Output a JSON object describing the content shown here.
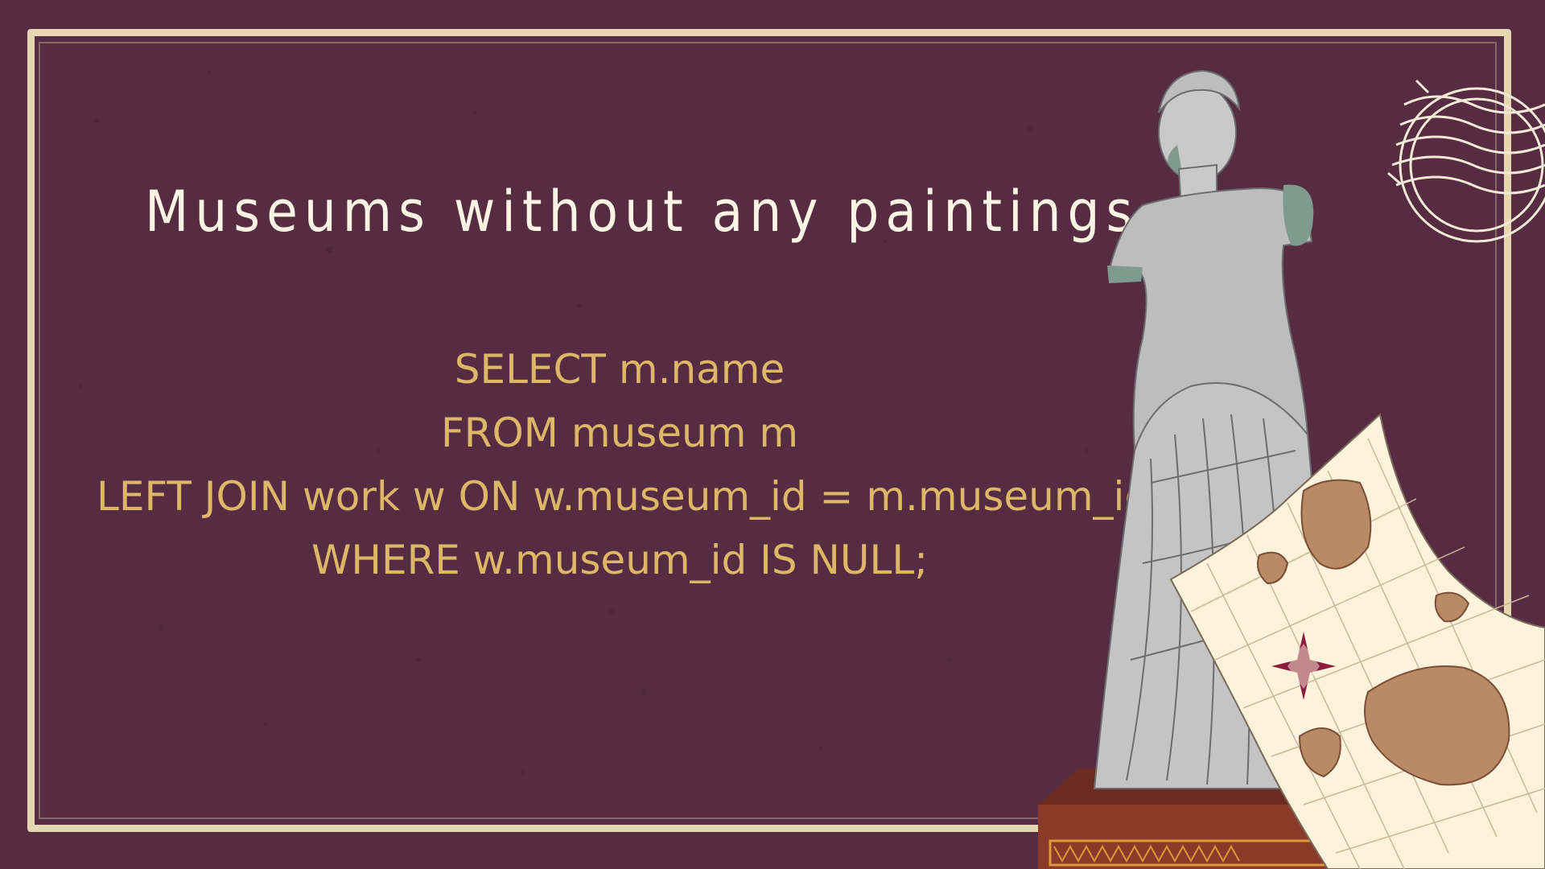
{
  "slide": {
    "title": "Museums without any paintings",
    "code_lines": [
      "SELECT m.name",
      "FROM museum m",
      "LEFT JOIN work w ON w.museum_id = m.museum_id",
      "WHERE w.museum_id IS NULL;"
    ]
  },
  "colors": {
    "background": "#552c41",
    "frame": "#e7d6b2",
    "title": "#fbf4e4",
    "code": "#ddb768",
    "statue": "#bdbdbd",
    "map_paper": "#fdf3dc",
    "map_land": "#b98a66"
  },
  "illustrations": {
    "statue": "venus-statue-icon",
    "map": "treasure-map-icon",
    "stamp": "postmark-stamp-icon",
    "pedestal": "pedestal-icon"
  }
}
